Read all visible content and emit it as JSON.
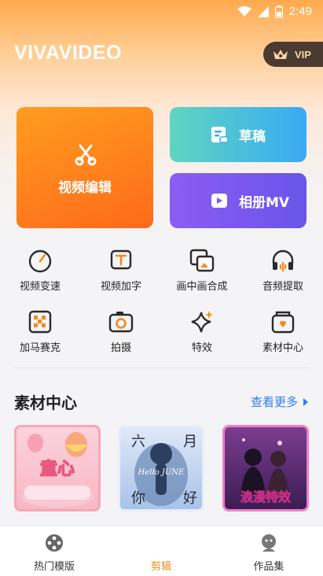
{
  "status_bar": {
    "time": "2:49"
  },
  "header": {
    "brand": "VIVAVIDEO",
    "vip_label": "VIP"
  },
  "quick_actions": {
    "main": {
      "label": "视频编辑",
      "icon": "scissors-icon"
    },
    "draft": {
      "label": "草稿",
      "icon": "draft-icon"
    },
    "album": {
      "label": "相册MV",
      "icon": "album-mv-icon"
    }
  },
  "tools": [
    {
      "label": "视频变速",
      "icon": "speedometer-icon"
    },
    {
      "label": "视频加字",
      "icon": "text-icon"
    },
    {
      "label": "画中画合成",
      "icon": "picture-in-picture-icon"
    },
    {
      "label": "音频提取",
      "icon": "headphones-icon"
    },
    {
      "label": "加马赛克",
      "icon": "mosaic-icon"
    },
    {
      "label": "拍摄",
      "icon": "camera-icon"
    },
    {
      "label": "特效",
      "icon": "sparkle-icon"
    },
    {
      "label": "素材中心",
      "icon": "material-box-icon"
    }
  ],
  "materials": {
    "title": "素材中心",
    "see_more": "查看更多",
    "items": [
      {
        "label": "童心"
      },
      {
        "label": "六月你好",
        "subtext": "Hello JUNE"
      },
      {
        "label": "浪漫特效"
      }
    ]
  },
  "bottom_nav": [
    {
      "label": "热门模版",
      "icon": "film-reel-icon",
      "active": false
    },
    {
      "label": "剪辑",
      "icon": "edit-icon",
      "active": true
    },
    {
      "label": "作品集",
      "icon": "portfolio-icon",
      "active": false
    }
  ],
  "colors": {
    "accent": "#f28a1a",
    "link": "#2b7df6"
  }
}
